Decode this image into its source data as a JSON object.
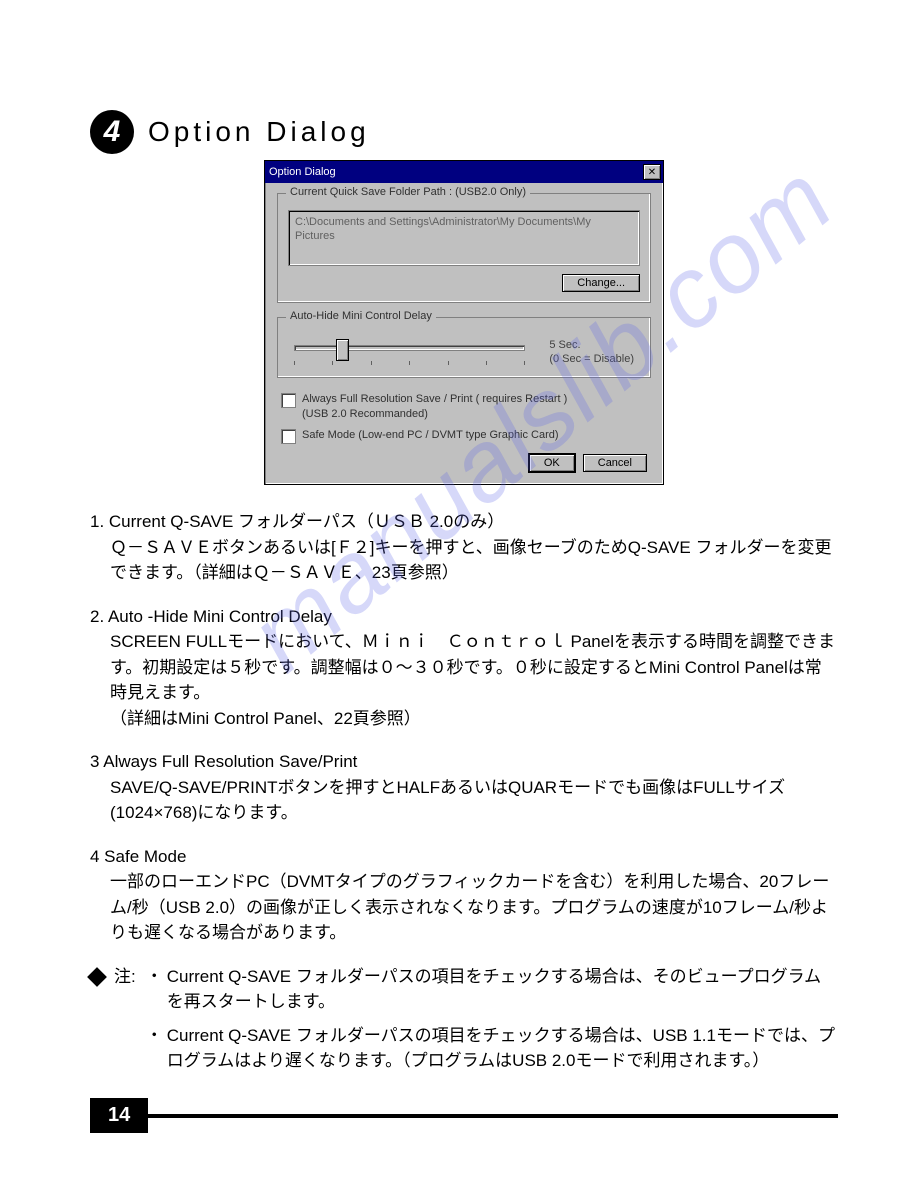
{
  "section": {
    "number": "4",
    "title": "Option Dialog"
  },
  "dialog": {
    "title": "Option Dialog",
    "group_path": {
      "legend": "Current Quick Save Folder Path : (USB2.0 Only)",
      "path": "C:\\Documents and Settings\\Administrator\\My Documents\\My Pictures",
      "change_button": "Change..."
    },
    "group_delay": {
      "legend": "Auto-Hide Mini Control Delay",
      "value_line1": "5   Sec.",
      "value_line2": "(0 Sec = Disable)"
    },
    "chk_fullres": {
      "line1": "Always Full Resolution Save / Print  ( requires Restart )",
      "line2": "(USB 2.0 Recommanded)"
    },
    "chk_safe": "Safe Mode (Low-end PC / DVMT type Graphic Card)",
    "ok": "OK",
    "cancel": "Cancel"
  },
  "items": [
    {
      "title": "1. Current Q-SAVE フォルダーパス（ＵＳＢ 2.0のみ）",
      "body": "Ｑ－ＳＡＶＥボタンあるいは[Ｆ２]キーを押すと、画像セーブのためQ-SAVE フォルダーを変更できます。（詳細はＱ－ＳＡＶＥ、23頁参照）"
    },
    {
      "title": "2. Auto -Hide Mini Control Delay",
      "body": "SCREEN FULLモードにおいて、Ｍｉｎｉ　Ｃｏｎｔｒｏｌ Panelを表示する時間を調整できます。初期設定は５秒です。調整幅は０～３０秒です。０秒に設定するとMini Control Panelは常時見えます。\n（詳細はMini Control Panel、22頁参照）"
    },
    {
      "title": "3 Always Full Resolution Save/Print",
      "body": "SAVE/Q-SAVE/PRINTボタンを押すとHALFあるいはQUARモードでも画像はFULLサイズ(1024×768)になります。"
    },
    {
      "title": "4 Safe Mode",
      "body": "一部のローエンドPC（DVMTタイプのグラフィックカードを含む）を利用した場合、20フレーム/秒（USB 2.0）の画像が正しく表示されなくなります。プログラムの速度が10フレーム/秒よりも遅くなる場合があります。"
    }
  ],
  "notes": {
    "label": "注:",
    "lines": [
      "Current Q-SAVE フォルダーパスの項目をチェックする場合は、そのビュープログラムを再スタートします。",
      "Current Q-SAVE フォルダーパスの項目をチェックする場合は、USB 1.1モードでは、プログラムはより遅くなります。（プログラムはUSB 2.0モードで利用されます。）"
    ]
  },
  "watermark": "manualslib.com",
  "page_number": "14"
}
